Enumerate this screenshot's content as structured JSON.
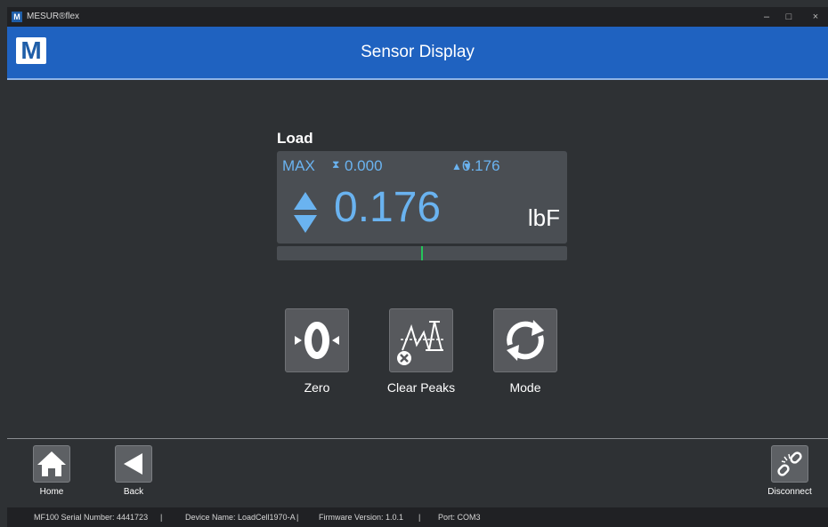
{
  "window": {
    "app_icon": "M",
    "title": "MESUR®flex",
    "controls": {
      "minimize": "–",
      "maximize": "□",
      "close": "×"
    }
  },
  "header": {
    "logo": "M",
    "title": "Sensor Display"
  },
  "sensor": {
    "label": "Load",
    "max_label": "MAX",
    "peak_icon": "⧗",
    "peak_value": "0.000",
    "current_icon": "▲▼",
    "current_value": "0.176",
    "value": "0.176",
    "unit": "lbF",
    "bar_fraction": 0.5
  },
  "actions": {
    "zero_label": "Zero",
    "clear_peaks_label": "Clear Peaks",
    "mode_label": "Mode"
  },
  "nav": {
    "home_label": "Home",
    "back_label": "Back",
    "disconnect_label": "Disconnect"
  },
  "status": {
    "serial": "MF100 Serial Number: 4441723",
    "sep1": "|",
    "device": "Device Name: LoadCell1970-A",
    "sep2": "|",
    "firmware": "Firmware Version: 1.0.1",
    "sep3": "|",
    "port": "Port: COM3"
  },
  "colors": {
    "header_blue": "#1f62c0",
    "value_blue": "#6ab3f0",
    "bar_marker": "#25c55b",
    "background": "#2e3134"
  }
}
